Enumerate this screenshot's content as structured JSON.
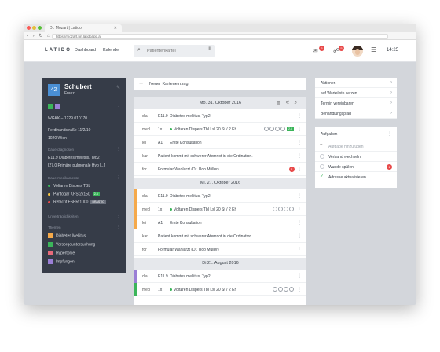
{
  "browser": {
    "tab_title": "Dr. Mozart | Latido",
    "tab_close": "✕",
    "url": "https://mozart.hn.latidoapp.at"
  },
  "appbar": {
    "logo": "LATIDO",
    "nav": [
      "Dashboard",
      "Kalender"
    ],
    "search_placeholder": "Patientenkartei",
    "messages_badge": "3",
    "tasks_badge": "5",
    "time": "14:25"
  },
  "patient": {
    "number": "42",
    "last_name": "Schubert",
    "first_name": "Franz",
    "color_tags": [
      "#3bb55a",
      "#9b7fd6"
    ],
    "insurance": "WGKK – 1229 010170",
    "address_line1": "Ferdinandstraße 11/2/10",
    "address_line2": "1020 Wien",
    "sections": {
      "diagnoses": "Dauerdiagnosen",
      "medication": "Dauermedikamente",
      "intolerances": "Unverträglichkeiten",
      "themes": "Themen"
    },
    "diagnoses": [
      {
        "code": "E11.9",
        "text": "Diabetes mellitus, Typ2"
      },
      {
        "code": "I27.0",
        "text": "Primäre pulmonale Hyp [...]"
      }
    ],
    "medication": [
      {
        "text": "Voltaren Dispers TBL",
        "color": "#3bb55a",
        "tag": ""
      },
      {
        "text": "Pantogar KPS 2x150",
        "color": "#f5c542",
        "tag": "2-6",
        "tag_color": "#3bb55a"
      },
      {
        "text": "Retacrit FSPR 1000",
        "color": "#e84a4a",
        "tag": "DRASTIC",
        "tag_color": "#6a707c"
      }
    ],
    "themes": [
      {
        "text": "Diabetes Mellitus",
        "color": "#f5a94a"
      },
      {
        "text": "Vorsorgeuntersuchung",
        "color": "#3bb55a"
      },
      {
        "text": "Hypertonie",
        "color": "#e86a7a"
      },
      {
        "text": "Impfungen",
        "color": "#9b7fd6"
      }
    ]
  },
  "timeline": {
    "new_entry": "Neuer Karteneintrag",
    "dates": [
      "Mo. 31. Oktober 2016",
      "Mi. 27. Oktober 2016",
      "Di 21. August 2016"
    ],
    "rows": [
      {
        "type": "dia",
        "code": "E11.9",
        "text": "Diabetes mellitus, Typ2",
        "bar": ""
      },
      {
        "type": "med",
        "code": "1x",
        "text": "Voltaren Dispers Tbl Lsl 20 St / 2 Eh",
        "bar": "",
        "tag": "2-6"
      },
      {
        "type": "lei",
        "code": "A1",
        "text": "Erste Konsultation",
        "bar": ""
      },
      {
        "type": "kar",
        "code": "",
        "text": "Patient kommt mit schwerer Atemnot in die Ordination.",
        "bar": ""
      },
      {
        "type": "for",
        "code": "",
        "text": "Formular Wahlarzt (Dr. Udo Müller)",
        "bar": "",
        "badge": "1"
      },
      {
        "type": "dia",
        "code": "E11.9",
        "text": "Diabetes mellitus, Typ2",
        "bar": "#f5a94a"
      },
      {
        "type": "med",
        "code": "1x",
        "text": "Voltaren Dispers Tbl Lsl 20 St / 2 Eh",
        "bar": "#f5a94a"
      },
      {
        "type": "lei",
        "code": "A1",
        "text": "Erste Konsultation",
        "bar": "#f5a94a"
      },
      {
        "type": "kar",
        "code": "",
        "text": "Patient kommt mit schwerer Atemnot in die Ordination.",
        "bar": ""
      },
      {
        "type": "for",
        "code": "",
        "text": "Formular Wahlarzt (Dr. Udo Müller)",
        "bar": ""
      },
      {
        "type": "dia",
        "code": "E11.9",
        "text": "Diabetes mellitus, Typ2",
        "bar": "#9b7fd6"
      },
      {
        "type": "med",
        "code": "1x",
        "text": "Voltaren Dispers Tbl Lsl 20 St / 2 Eh",
        "bar": "#3bb55a"
      }
    ]
  },
  "actions": {
    "title": "Aktionen",
    "items": [
      "auf Warteliste setzen",
      "Termin vereinbaren",
      "Behandlungspfad"
    ]
  },
  "tasks": {
    "title": "Aufgaben",
    "add_placeholder": "Aufgabe hinzufügen",
    "items": [
      {
        "text": "Verband wechseln",
        "done": false,
        "badge": ""
      },
      {
        "text": "Wunde spülen",
        "done": false,
        "badge": "1"
      },
      {
        "text": "Adresse aktualisieren",
        "done": true,
        "badge": ""
      }
    ]
  }
}
